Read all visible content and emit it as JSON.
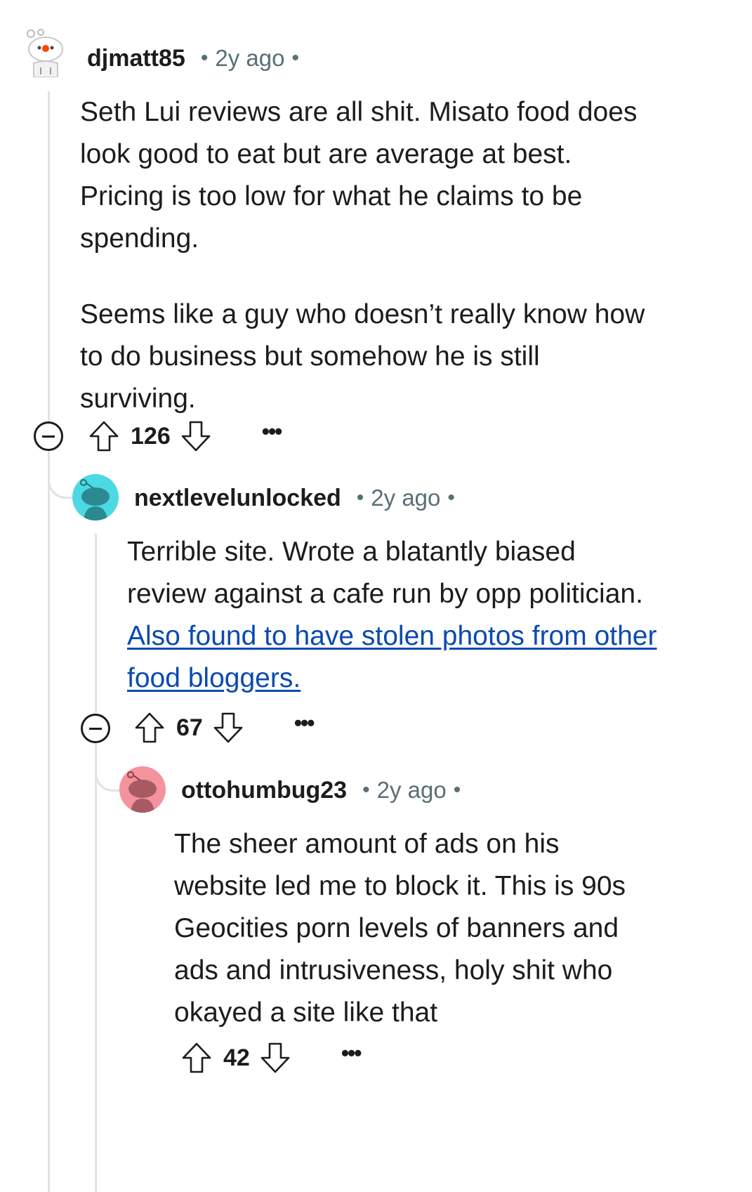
{
  "comments": [
    {
      "username": "djmatt85",
      "separator": "•",
      "time": "2y ago",
      "paragraphs": [
        "Seth Lui reviews are all shit. Misato food does look good to eat but are average at best. Pricing is too low for what he claims to be spending.",
        "Seems like a guy who doesn’t really know how to do business but somehow he is still surviving."
      ],
      "score": "126",
      "more": "•••"
    },
    {
      "username": "nextlevelunlocked",
      "separator": "•",
      "time": "2y ago",
      "text": "Terrible site. Wrote a blatantly biased review against a cafe run by opp politician.",
      "link_text": "Also found to have stolen photos from other food bloggers.",
      "score": "67",
      "more": "•••"
    },
    {
      "username": "ottohumbug23",
      "separator": "•",
      "time": "2y ago",
      "text": "The sheer amount of ads on his website led me to block it. This is 90s Geocities porn levels of banners and ads and intrusiveness, holy shit who okayed a site like that",
      "score": "42",
      "more": "•••"
    }
  ],
  "colors": {
    "text": "#1c1c1c",
    "meta": "#576f76",
    "link": "#0a4ab1",
    "thread_line": "#dfe3e6",
    "avatar_teal": "#4dd9e3",
    "avatar_pink": "#f4939e"
  }
}
